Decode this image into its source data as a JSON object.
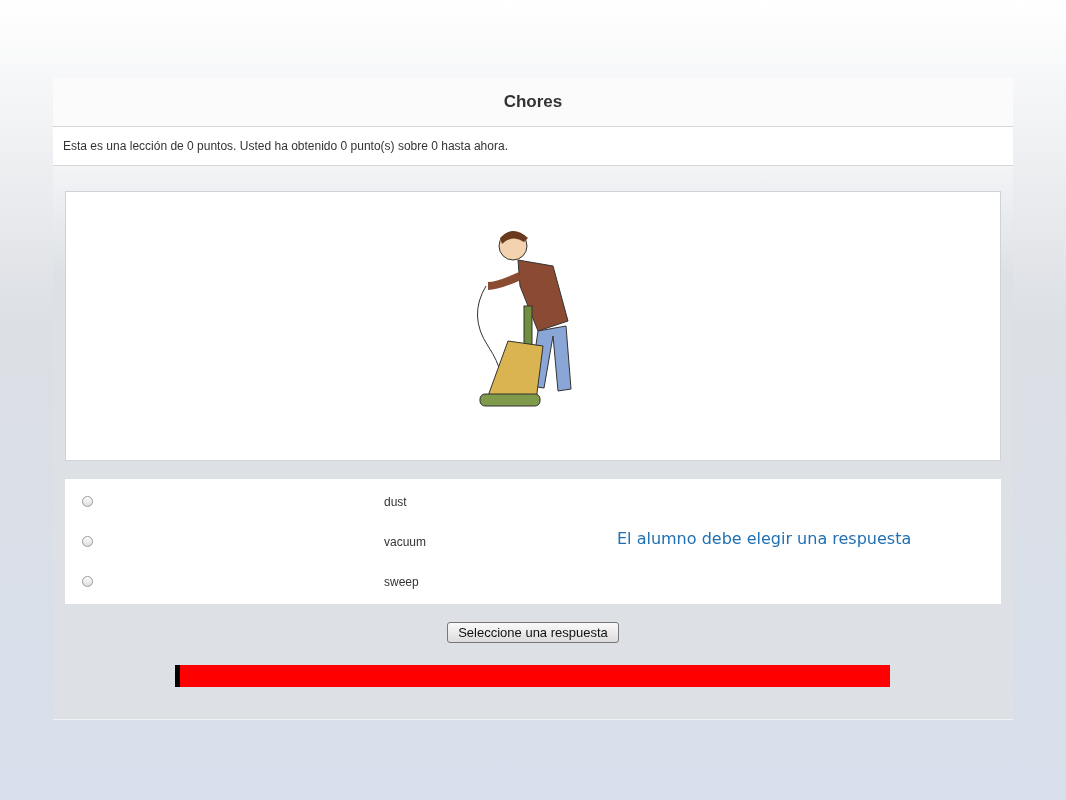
{
  "lesson": {
    "title": "Chores",
    "info": "Esta es una lección de 0 puntos. Usted ha obtenido 0 punto(s) sobre 0 hasta ahora."
  },
  "answers": [
    {
      "label": "dust",
      "selected": false
    },
    {
      "label": "vacuum",
      "selected": false
    },
    {
      "label": "sweep",
      "selected": false
    }
  ],
  "note": "El alumno debe elegir una respuesta",
  "submit_button": "Seleccione una respuesta",
  "progress": {
    "level": 0.007
  }
}
